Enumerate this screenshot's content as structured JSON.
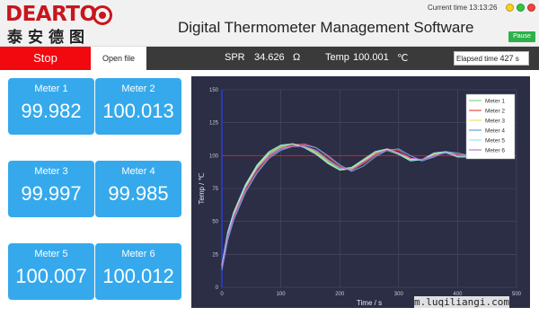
{
  "header": {
    "logo_en": "DEARTO",
    "logo_cn": "泰安德图",
    "title": "Digital Thermometer Management Software",
    "current_time_label": "Current time",
    "current_time": "13:13:26",
    "pause_label": "Pause"
  },
  "toolbar": {
    "stop_label": "Stop",
    "open_file_label": "Open file",
    "spr_label": "SPR",
    "spr_value": "34.626",
    "spr_unit": "Ω",
    "temp_label": "Temp",
    "temp_value": "100.001",
    "temp_unit": "℃",
    "elapsed_label": "Elapsed time",
    "elapsed_value": "427",
    "elapsed_unit": "s"
  },
  "meters": [
    {
      "label": "Meter 1",
      "value": "99.982"
    },
    {
      "label": "Meter 2",
      "value": "100.013"
    },
    {
      "label": "Meter 3",
      "value": "99.997"
    },
    {
      "label": "Meter 4",
      "value": "99.985"
    },
    {
      "label": "Meter 5",
      "value": "100.007"
    },
    {
      "label": "Meter 6",
      "value": "100.012"
    }
  ],
  "colors": {
    "stop": "#f2080f",
    "meter_card": "#35a9ec",
    "chart_bg": "#2b2e45",
    "setpoint_line": "#e01b24",
    "pause": "#2fb04c"
  },
  "watermark": "m.luqiliangi.com",
  "chart_data": {
    "type": "line",
    "xlabel": "Time / s",
    "ylabel": "Temp / ℃",
    "xlim": [
      0,
      500
    ],
    "ylim": [
      0,
      150
    ],
    "x_ticks": [
      0,
      100,
      200,
      300,
      400,
      500
    ],
    "y_ticks": [
      0,
      25,
      50,
      75,
      100,
      125,
      150
    ],
    "grid": true,
    "legend_position": "top-right",
    "setpoint": 100,
    "series": [
      {
        "name": "Meter 1",
        "color": "#7dd98a",
        "x": [
          0,
          10,
          20,
          40,
          60,
          80,
          100,
          120,
          140,
          160,
          180,
          200,
          220,
          240,
          260,
          280,
          300,
          320,
          340,
          360,
          380,
          400,
          420
        ],
        "y": [
          15,
          40,
          55,
          76,
          91,
          101,
          106,
          108,
          107,
          103,
          96,
          90,
          91,
          96,
          101,
          104,
          101,
          97,
          97,
          101,
          102,
          99,
          99
        ]
      },
      {
        "name": "Meter 2",
        "color": "#e84a4a",
        "x": [
          0,
          10,
          20,
          40,
          60,
          80,
          100,
          120,
          140,
          160,
          180,
          200,
          220,
          240,
          260,
          280,
          300,
          320,
          340,
          360,
          380,
          400,
          420
        ],
        "y": [
          14,
          37,
          52,
          73,
          88,
          99,
          105,
          108,
          109,
          106,
          99,
          92,
          89,
          94,
          100,
          105,
          104,
          98,
          96,
          100,
          103,
          101,
          100
        ]
      },
      {
        "name": "Meter 3",
        "color": "#e6e36a",
        "x": [
          0,
          10,
          20,
          40,
          60,
          80,
          100,
          120,
          140,
          160,
          180,
          200,
          220,
          240,
          260,
          280,
          300,
          320,
          340,
          360,
          380,
          400,
          420
        ],
        "y": [
          16,
          41,
          56,
          77,
          92,
          102,
          107,
          109,
          107,
          102,
          95,
          89,
          90,
          96,
          102,
          105,
          102,
          97,
          97,
          101,
          103,
          100,
          100
        ]
      },
      {
        "name": "Meter 4",
        "color": "#5f9fe0",
        "x": [
          0,
          10,
          20,
          40,
          60,
          80,
          100,
          120,
          140,
          160,
          180,
          200,
          220,
          240,
          260,
          280,
          300,
          320,
          340,
          360,
          380,
          400,
          420
        ],
        "y": [
          13,
          36,
          51,
          72,
          87,
          98,
          104,
          107,
          108,
          106,
          100,
          93,
          88,
          92,
          99,
          104,
          105,
          100,
          96,
          99,
          103,
          102,
          100
        ]
      },
      {
        "name": "Meter 5",
        "color": "#8ee8ea",
        "x": [
          0,
          10,
          20,
          40,
          60,
          80,
          100,
          120,
          140,
          160,
          180,
          200,
          220,
          240,
          260,
          280,
          300,
          320,
          340,
          360,
          380,
          400,
          420
        ],
        "y": [
          17,
          42,
          57,
          78,
          93,
          103,
          108,
          109,
          106,
          101,
          94,
          89,
          91,
          97,
          103,
          105,
          101,
          96,
          97,
          102,
          103,
          99,
          99
        ]
      },
      {
        "name": "Meter 6",
        "color": "#c86fd8",
        "x": [
          0,
          10,
          20,
          40,
          60,
          80,
          100,
          120,
          140,
          160,
          180,
          200,
          220,
          240,
          260,
          280,
          300,
          320,
          340,
          360,
          380,
          400,
          420
        ],
        "y": [
          15,
          39,
          54,
          75,
          90,
          100,
          105,
          107,
          107,
          104,
          97,
          91,
          89,
          95,
          101,
          104,
          102,
          98,
          97,
          100,
          102,
          100,
          100
        ]
      }
    ]
  }
}
